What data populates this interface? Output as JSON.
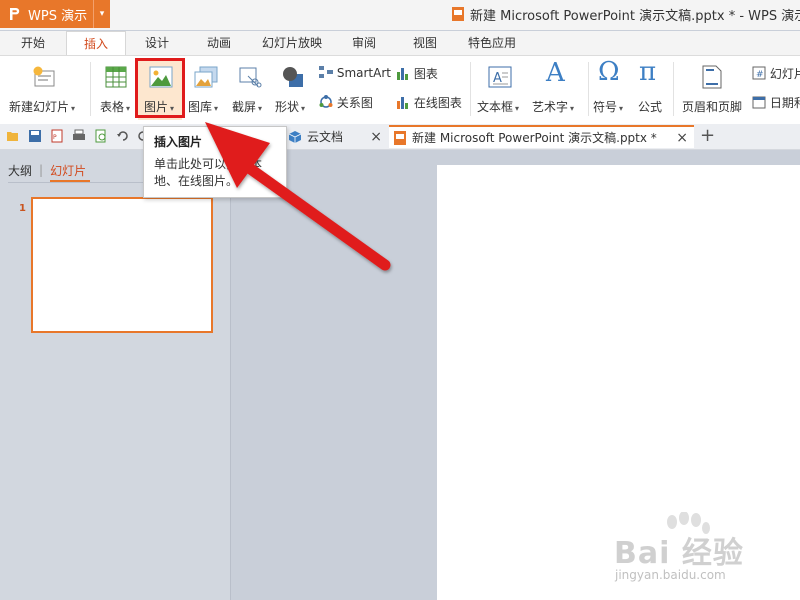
{
  "app": {
    "menu_button": "WPS 演示",
    "window_title": "新建 Microsoft PowerPoint 演示文稿.pptx * - WPS 演示"
  },
  "ribbon_tabs": [
    "开始",
    "插入",
    "设计",
    "动画",
    "幻灯片放映",
    "审阅",
    "视图",
    "特色应用"
  ],
  "active_tab": "插入",
  "ribbon": {
    "new_slide": "新建幻灯片",
    "table": "表格",
    "picture": "图片",
    "gallery": "图库",
    "screenshot": "截屏",
    "shapes": "形状",
    "smartart": "SmartArt",
    "chart": "图表",
    "relationship": "关系图",
    "online_chart": "在线图表",
    "textbox": "文本框",
    "wordart": "艺术字",
    "symbol": "符号",
    "formula": "公式",
    "header_footer": "页眉和页脚",
    "slide_number": "幻灯片",
    "date_time": "日期和",
    "omega_glyph": "Ω",
    "pi_glyph": "π",
    "wordart_glyph": "A"
  },
  "doc_tabs": {
    "cloud": "云文档",
    "current": "新建 Microsoft PowerPoint 演示文稿.pptx *",
    "close_glyph": "×",
    "add_glyph": "+"
  },
  "tooltip": {
    "title": "插入图片",
    "description": "单击此处可以插入本地、在线图片。"
  },
  "panel": {
    "outline_tab": "大纲",
    "divider": "|",
    "slides_tab": "幻灯片",
    "slide_number": "1"
  },
  "watermark": {
    "brand": "Bai 经验",
    "url": "jingyan.baidu.com"
  },
  "colors": {
    "accent_orange": "#e8772a",
    "active_tab_text": "#d24a1d",
    "annotation_red": "#e01b1b"
  }
}
